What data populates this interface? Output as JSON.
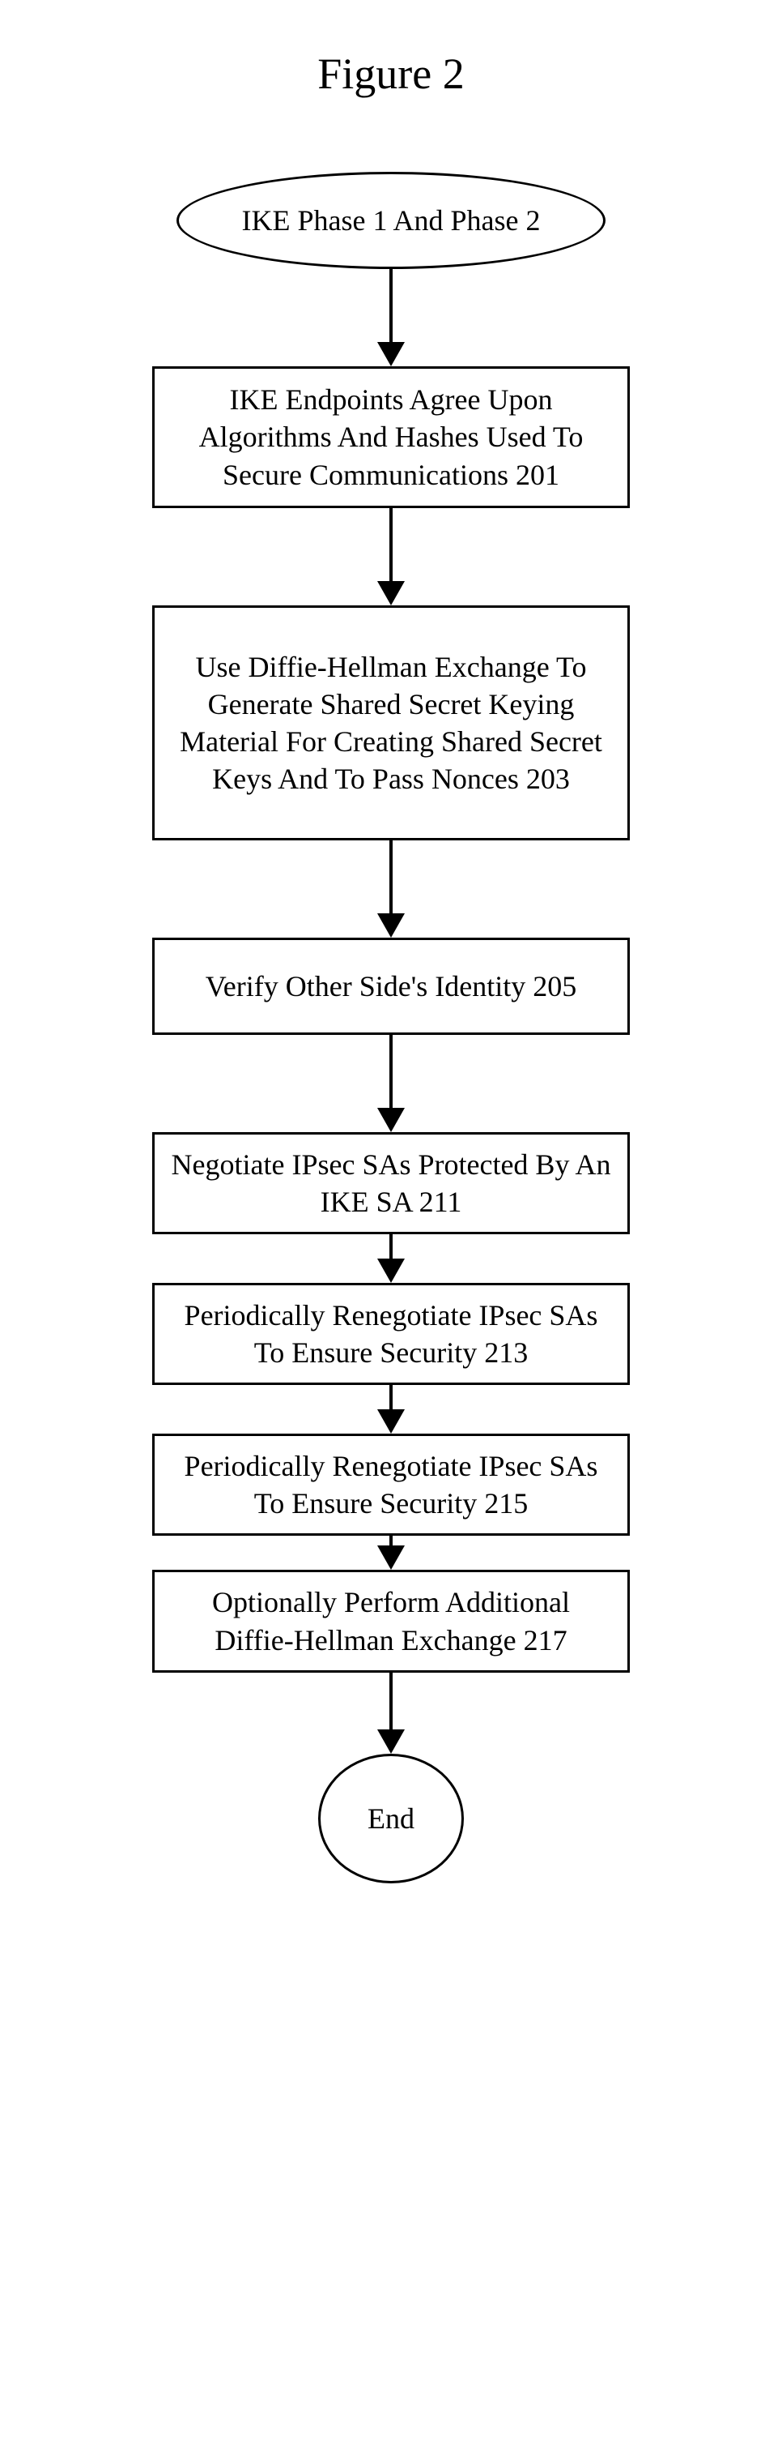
{
  "figure_label": "Figure 2",
  "start": {
    "label": "IKE Phase 1 And Phase 2"
  },
  "steps": [
    {
      "text": "IKE Endpoints Agree Upon Algorithms And Hashes Used To Secure Communications 201"
    },
    {
      "text": "Use Diffie-Hellman Exchange To Generate Shared Secret Keying Material For Creating Shared Secret Keys And To Pass Nonces 203"
    },
    {
      "text": "Verify Other Side's Identity 205"
    },
    {
      "text": "Negotiate IPsec SAs Protected By An IKE SA 211"
    },
    {
      "text": "Periodically Renegotiate IPsec SAs To Ensure Security 213"
    },
    {
      "text": "Periodically Renegotiate IPsec SAs To Ensure Security 215"
    },
    {
      "text": "Optionally Perform Additional Diffie-Hellman Exchange 217"
    }
  ],
  "end": {
    "label": "End"
  }
}
